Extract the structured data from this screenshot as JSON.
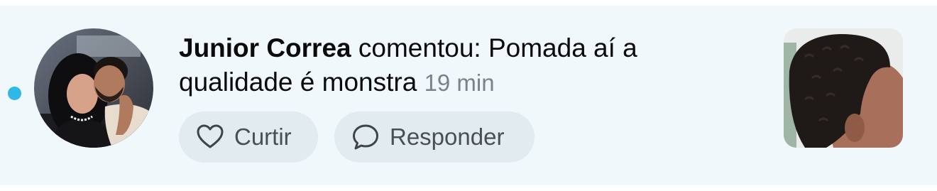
{
  "notification": {
    "author": "Junior Correa",
    "text": "comentou: Pomada aí a qualidade é monstra",
    "time": "19 min",
    "unread": true,
    "accent_color": "#2fb8e6",
    "background_color": "#f0f8fc"
  },
  "actions": {
    "like_label": "Curtir",
    "like_icon": "heart-icon",
    "reply_label": "Responder",
    "reply_icon": "speech-bubble-icon"
  },
  "avatar": {
    "description_icon": "profile-photo"
  },
  "thumbnail": {
    "description_icon": "post-photo"
  }
}
